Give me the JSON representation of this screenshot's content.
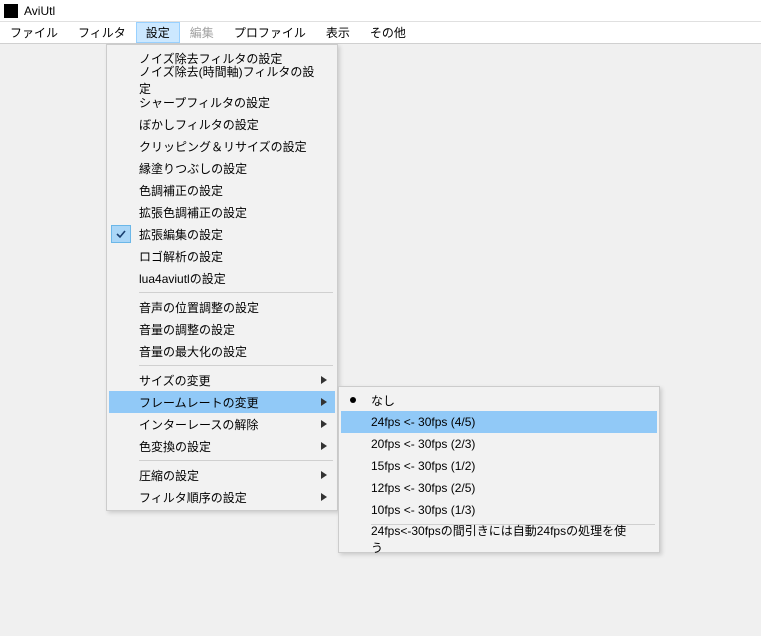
{
  "window": {
    "title": "AviUtl"
  },
  "menubar": {
    "items": [
      {
        "label": "ファイル",
        "active": false,
        "disabled": false
      },
      {
        "label": "フィルタ",
        "active": false,
        "disabled": false
      },
      {
        "label": "設定",
        "active": true,
        "disabled": false
      },
      {
        "label": "編集",
        "active": false,
        "disabled": true
      },
      {
        "label": "プロファイル",
        "active": false,
        "disabled": false
      },
      {
        "label": "表示",
        "active": false,
        "disabled": false
      },
      {
        "label": "その他",
        "active": false,
        "disabled": false
      }
    ]
  },
  "settings_menu": {
    "group1": [
      "ノイズ除去フィルタの設定",
      "ノイズ除去(時間軸)フィルタの設定",
      "シャープフィルタの設定",
      "ぼかしフィルタの設定",
      "クリッピング＆リサイズの設定",
      "縁塗りつぶしの設定",
      "色調補正の設定",
      "拡張色調補正の設定"
    ],
    "checked_item": "拡張編集の設定",
    "group1b": [
      "ロゴ解析の設定",
      "lua4aviutlの設定"
    ],
    "group2": [
      "音声の位置調整の設定",
      "音量の調整の設定",
      "音量の最大化の設定"
    ],
    "group3": {
      "size": "サイズの変更",
      "framerate": "フレームレートの変更",
      "interlace": "インターレースの解除",
      "color": "色変換の設定"
    },
    "group4": {
      "compress": "圧縮の設定",
      "order": "フィルタ順序の設定"
    }
  },
  "framerate_submenu": {
    "none": "なし",
    "options": [
      "24fps <- 30fps (4/5)",
      "20fps <- 30fps (2/3)",
      "15fps <- 30fps (1/2)",
      "12fps <- 30fps (2/5)",
      "10fps <- 30fps (1/3)"
    ],
    "auto": "24fps<-30fpsの間引きには自動24fpsの処理を使う"
  }
}
